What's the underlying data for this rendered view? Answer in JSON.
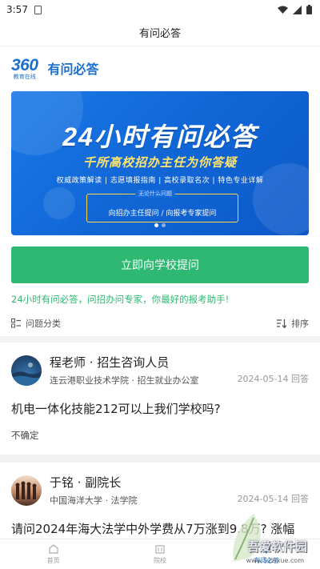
{
  "status_bar": {
    "time": "3:57"
  },
  "header": {
    "title": "有问必答"
  },
  "brand": {
    "logo_number": "360",
    "logo_sub": "教育在线",
    "name": "有问必答"
  },
  "banner": {
    "title": "24小时有问必答",
    "subtitle": "千所高校招办主任为你答疑",
    "tags": "权威政策解读 | 志愿填报指南 | 高校录取名次 | 特色专业详解",
    "box_title": "无论什么问题",
    "box_text": "向招办主任提问 / 向报考专家提问",
    "slide_count": 2,
    "active_slide": 1
  },
  "ask_button": {
    "label": "立即向学校提问"
  },
  "slogan": "24小时有问必答，问招办问专家，你最好的报考助手!",
  "filters": {
    "category_label": "问题分类",
    "sort_label": "排序"
  },
  "questions": [
    {
      "name": "程老师 · 招生咨询人员",
      "org": "连云港职业技术学院 · 招生就业办公室",
      "date": "2024-05-14",
      "meta_suffix": "回答",
      "question": "机电一体化技能212可以上我们学校吗?",
      "answer": "不确定"
    },
    {
      "name": "于铭 · 副院长",
      "org": "中国海洋大学 · 法学院",
      "date": "2024-05-14",
      "meta_suffix": "回答",
      "question": "请问2024年海大法学中外学费从7万涨到9.8万? 涨幅",
      "answer": ""
    }
  ],
  "bottom_nav": [
    {
      "label": "首页",
      "icon": "home-icon"
    },
    {
      "label": "院校",
      "icon": "school-icon"
    },
    {
      "label": "有问必答",
      "icon": "qa-icon",
      "active": true
    }
  ],
  "watermark": {
    "text": "吾爱软件园",
    "url": "www.52zixue.com"
  },
  "colors": {
    "brand_blue": "#1b6fd0",
    "green": "#2fb872"
  }
}
